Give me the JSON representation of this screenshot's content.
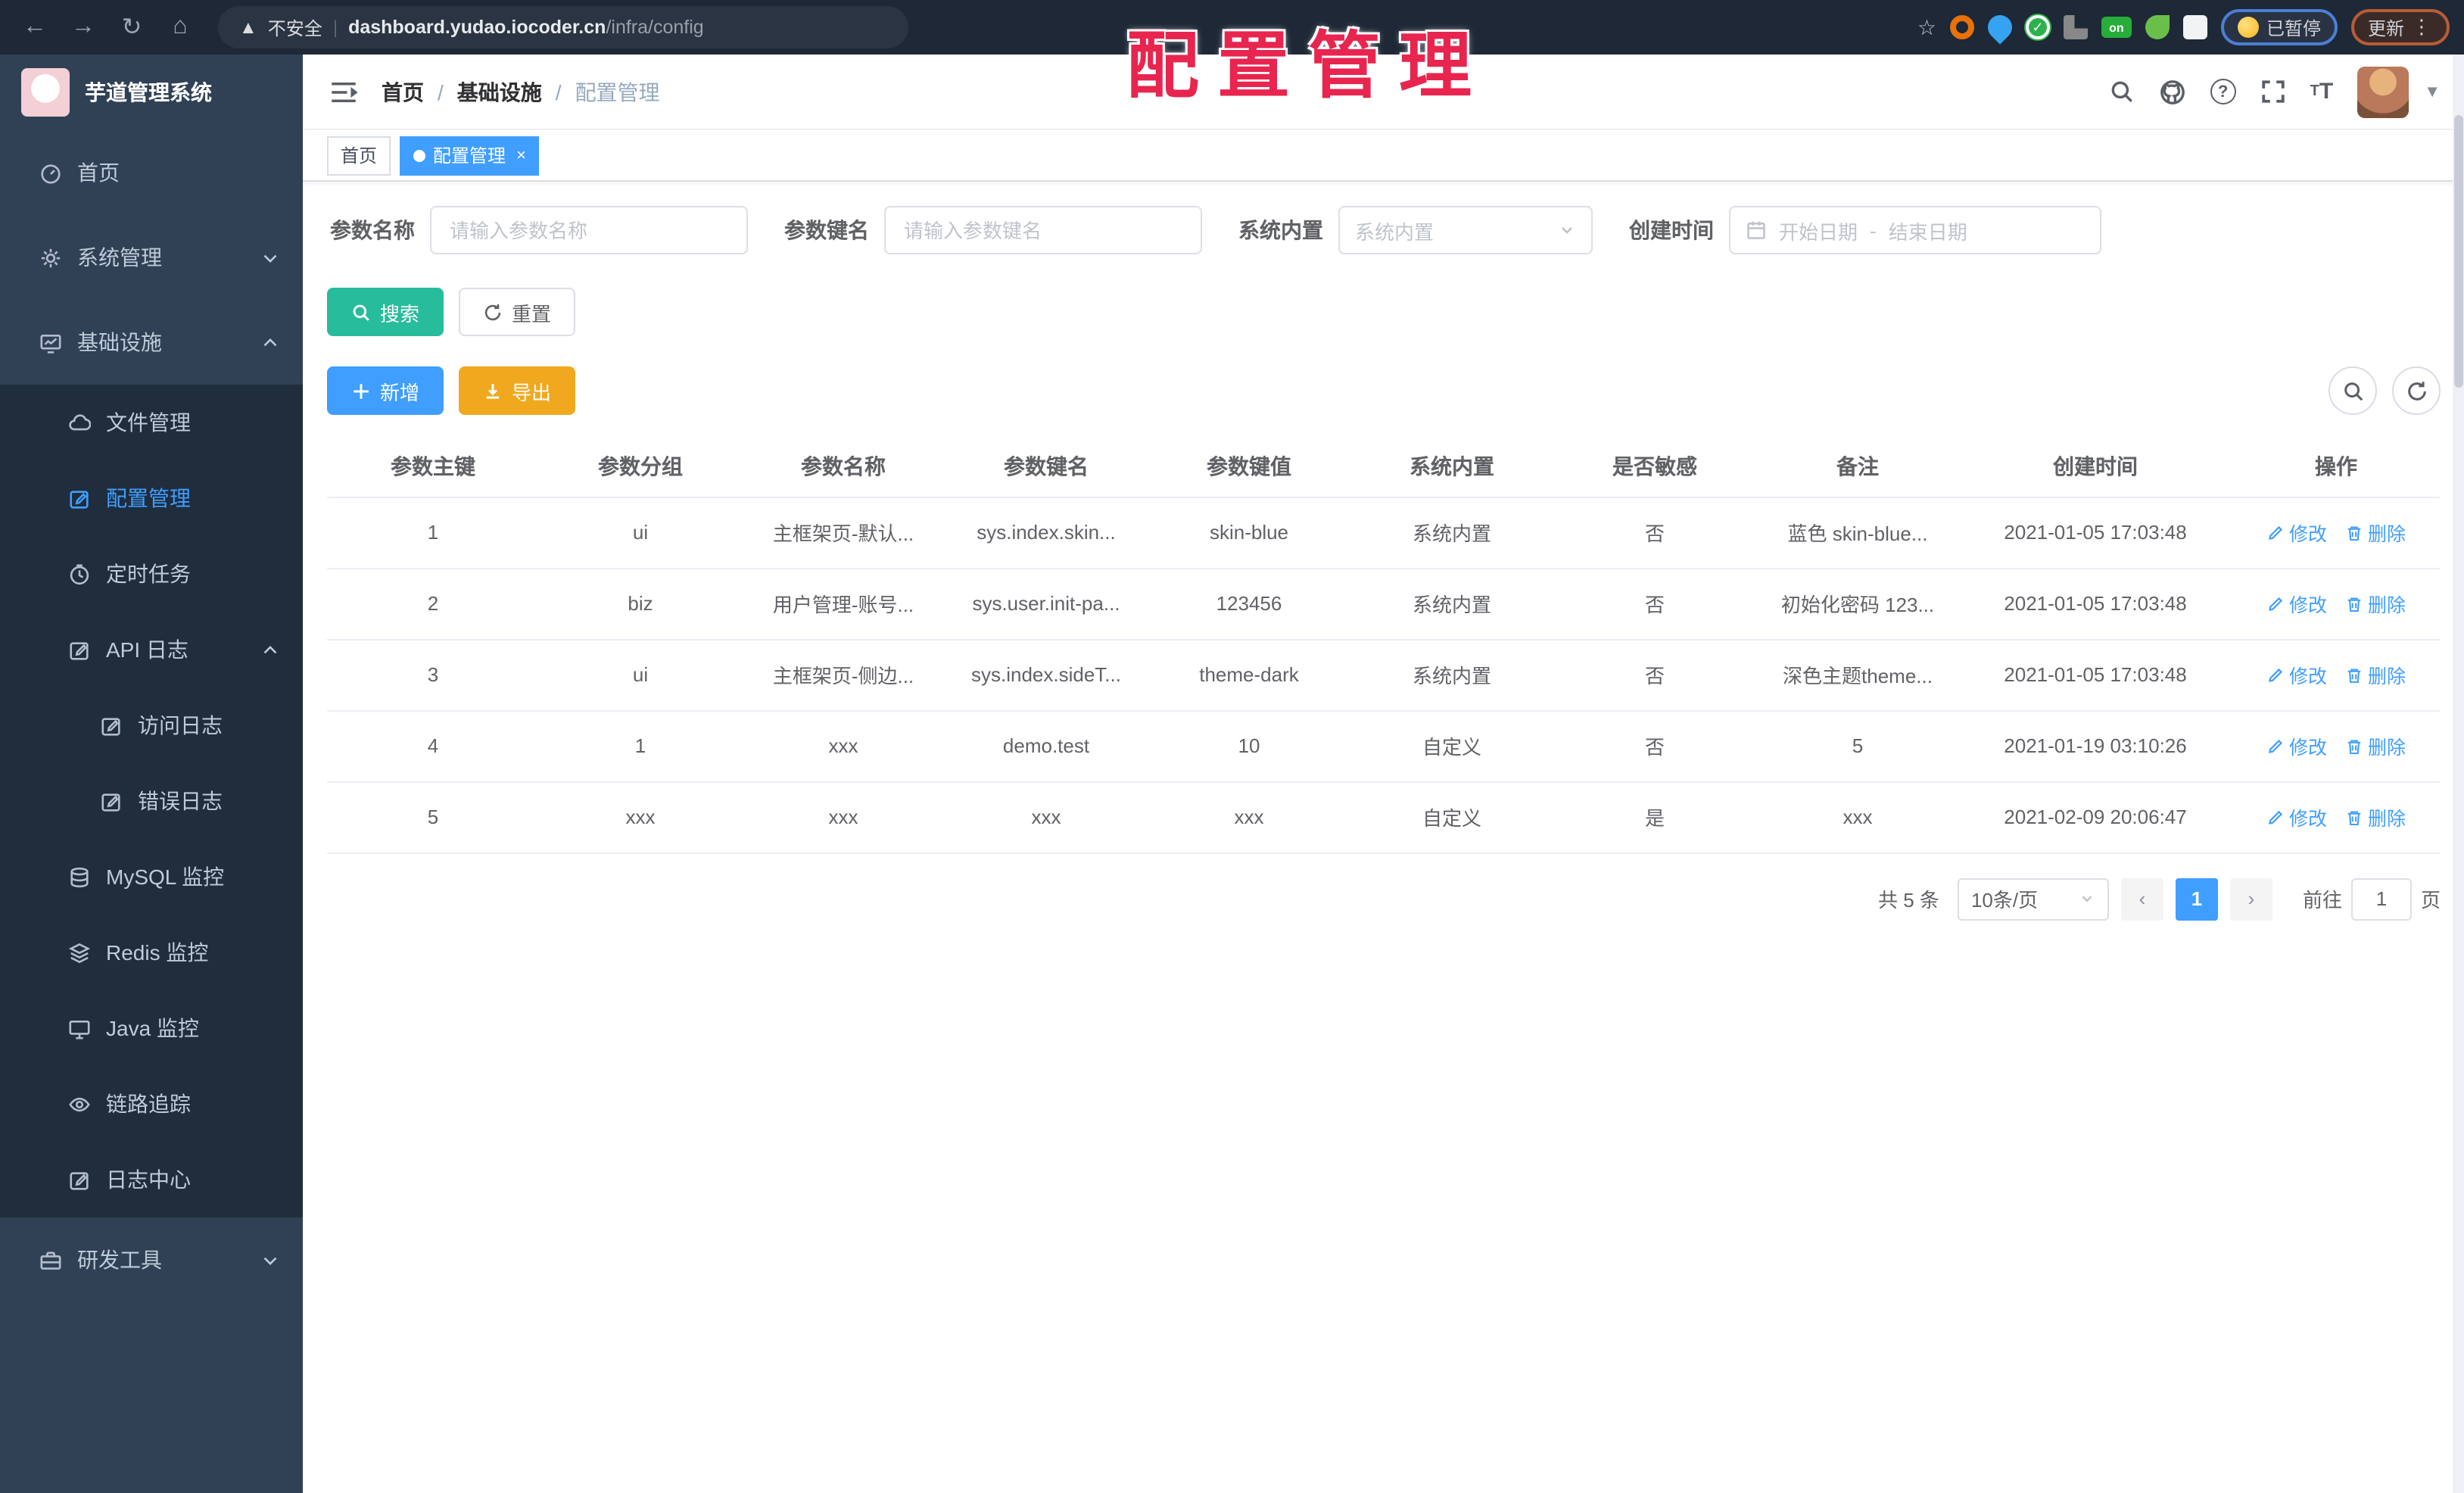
{
  "overlay": {
    "title": "配置管理"
  },
  "colors": {
    "accent": "#409EFF",
    "success": "#27BC9C",
    "warning": "#F0A91F",
    "annotation": "#E8254F",
    "sidebar-bg": "#304156",
    "submenu-bg": "#1F2D3D",
    "sidebar-text": "#BFCBD9",
    "chrome-bg": "#1E2836",
    "chrome-pill": "#2A3443"
  },
  "browser": {
    "security_label": "不安全",
    "url_domain": "dashboard.yudao.iocoder.cn",
    "url_path": "/infra/config",
    "extension_on_badge": "on",
    "paused_badge": "已暂停",
    "update_button": "更新"
  },
  "app": {
    "title": "芋道管理系统"
  },
  "breadcrumb": {
    "items": [
      "首页",
      "基础设施",
      "配置管理"
    ],
    "separator": "/"
  },
  "tabs": [
    {
      "label": "首页",
      "active": false,
      "closable": false
    },
    {
      "label": "配置管理",
      "active": true,
      "closable": true
    }
  ],
  "sidebar": {
    "items": [
      {
        "label": "首页",
        "icon": "dashboard"
      },
      {
        "label": "系统管理",
        "icon": "gear",
        "chevron": "down"
      },
      {
        "label": "基础设施",
        "icon": "infra",
        "chevron": "up",
        "children": [
          {
            "label": "文件管理",
            "icon": "cloud"
          },
          {
            "label": "配置管理",
            "icon": "config",
            "active": true
          },
          {
            "label": "定时任务",
            "icon": "timer"
          },
          {
            "label": "API 日志",
            "icon": "log",
            "chevron": "up",
            "children": [
              {
                "label": "访问日志",
                "icon": "log"
              },
              {
                "label": "错误日志",
                "icon": "log"
              }
            ]
          },
          {
            "label": "MySQL 监控",
            "icon": "database"
          },
          {
            "label": "Redis 监控",
            "icon": "layers"
          },
          {
            "label": "Java 监控",
            "icon": "monitor"
          },
          {
            "label": "链路追踪",
            "icon": "eye"
          },
          {
            "label": "日志中心",
            "icon": "log"
          }
        ]
      },
      {
        "label": "研发工具",
        "icon": "toolbox",
        "chevron": "down"
      }
    ]
  },
  "filters": {
    "name": {
      "label": "参数名称",
      "placeholder": "请输入参数名称"
    },
    "key": {
      "label": "参数键名",
      "placeholder": "请输入参数键名"
    },
    "builtin": {
      "label": "系统内置",
      "placeholder": "系统内置"
    },
    "create_time": {
      "label": "创建时间",
      "start_placeholder": "开始日期",
      "separator": "-",
      "end_placeholder": "结束日期"
    }
  },
  "actions": {
    "search": "搜索",
    "reset": "重置",
    "add": "新增",
    "export": "导出"
  },
  "table": {
    "columns": [
      "参数主键",
      "参数分组",
      "参数名称",
      "参数键名",
      "参数键值",
      "系统内置",
      "是否敏感",
      "备注",
      "创建时间",
      "操作"
    ],
    "rows": [
      [
        "1",
        "ui",
        "主框架页-默认...",
        "sys.index.skin...",
        "skin-blue",
        "系统内置",
        "否",
        "蓝色 skin-blue...",
        "2021-01-05 17:03:48"
      ],
      [
        "2",
        "biz",
        "用户管理-账号...",
        "sys.user.init-pa...",
        "123456",
        "系统内置",
        "否",
        "初始化密码 123...",
        "2021-01-05 17:03:48"
      ],
      [
        "3",
        "ui",
        "主框架页-侧边...",
        "sys.index.sideT...",
        "theme-dark",
        "系统内置",
        "否",
        "深色主题theme...",
        "2021-01-05 17:03:48"
      ],
      [
        "4",
        "1",
        "xxx",
        "demo.test",
        "10",
        "自定义",
        "否",
        "5",
        "2021-01-19 03:10:26"
      ],
      [
        "5",
        "xxx",
        "xxx",
        "xxx",
        "xxx",
        "自定义",
        "是",
        "xxx",
        "2021-02-09 20:06:47"
      ]
    ],
    "row_actions": [
      {
        "label": "修改",
        "icon": "pencil"
      },
      {
        "label": "删除",
        "icon": "trash"
      }
    ]
  },
  "pagination": {
    "total": "共 5 条",
    "page_size": "10条/页",
    "current_page": "1",
    "goto_label": "前往",
    "goto_value": "1",
    "page_label": "页"
  }
}
